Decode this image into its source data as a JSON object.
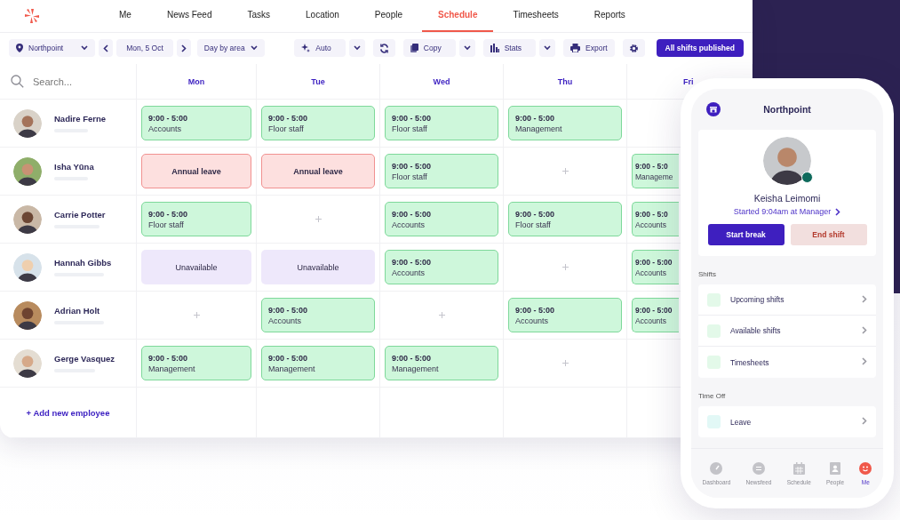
{
  "nav": [
    {
      "label": "Me",
      "selected": false
    },
    {
      "label": "News Feed",
      "selected": false
    },
    {
      "label": "Tasks",
      "selected": false
    },
    {
      "label": "Location",
      "selected": false
    },
    {
      "label": "People",
      "selected": false
    },
    {
      "label": "Schedule",
      "selected": true
    },
    {
      "label": "Timesheets",
      "selected": false
    },
    {
      "label": "Reports",
      "selected": false
    }
  ],
  "toolbar": {
    "location": "Northpoint",
    "date": "Mon, 5 Oct",
    "view": "Day by area",
    "actions": [
      {
        "kind": "auto",
        "label": "Auto"
      },
      {
        "kind": "refresh"
      },
      {
        "kind": "copy",
        "label": "Copy"
      },
      {
        "kind": "stats",
        "label": "Stats"
      },
      {
        "kind": "export",
        "label": "Export"
      },
      {
        "kind": "settings"
      }
    ],
    "publish": "All shifts published"
  },
  "search": {
    "placeholder": "Search..."
  },
  "days": [
    "Mon",
    "Tue",
    "Wed",
    "Thu",
    "Fri"
  ],
  "employees": [
    {
      "name": "Nadire Ferne",
      "cells": [
        {
          "kind": "shift",
          "time": "9:00 - 5:00",
          "area": "Accounts"
        },
        {
          "kind": "shift",
          "time": "9:00 - 5:00",
          "area": "Floor staff"
        },
        {
          "kind": "shift",
          "time": "9:00 - 5:00",
          "area": "Floor staff"
        },
        {
          "kind": "shift",
          "time": "9:00 - 5:00",
          "area": "Management"
        },
        {
          "kind": "blank"
        }
      ]
    },
    {
      "name": "Isha Yūna",
      "cells": [
        {
          "kind": "leave",
          "label": "Annual leave"
        },
        {
          "kind": "leave",
          "label": "Annual leave"
        },
        {
          "kind": "shift",
          "time": "9:00 - 5:00",
          "area": "Floor staff"
        },
        {
          "kind": "empty"
        },
        {
          "kind": "shift",
          "time": "9:00 - 5:0",
          "area": "Manageme"
        }
      ]
    },
    {
      "name": "Carrie Potter",
      "cells": [
        {
          "kind": "shift",
          "time": "9:00 - 5:00",
          "area": "Floor staff"
        },
        {
          "kind": "empty"
        },
        {
          "kind": "shift",
          "time": "9:00 - 5:00",
          "area": "Accounts"
        },
        {
          "kind": "shift",
          "time": "9:00 - 5:00",
          "area": "Floor staff"
        },
        {
          "kind": "shift",
          "time": "9:00 - 5:0",
          "area": "Accounts"
        }
      ]
    },
    {
      "name": "Hannah Gibbs",
      "cells": [
        {
          "kind": "unavailable",
          "label": "Unavailable"
        },
        {
          "kind": "unavailable",
          "label": "Unavailable"
        },
        {
          "kind": "shift",
          "time": "9:00 - 5:00",
          "area": "Accounts"
        },
        {
          "kind": "empty"
        },
        {
          "kind": "shift",
          "time": "9:00 - 5:00",
          "area": "Accounts"
        }
      ]
    },
    {
      "name": "Adrian Holt",
      "cells": [
        {
          "kind": "empty"
        },
        {
          "kind": "shift",
          "time": "9:00 - 5:00",
          "area": "Accounts"
        },
        {
          "kind": "empty"
        },
        {
          "kind": "shift",
          "time": "9:00 - 5:00",
          "area": "Accounts"
        },
        {
          "kind": "shift",
          "time": "9:00 - 5:00",
          "area": "Accounts"
        }
      ]
    },
    {
      "name": "Gerge Vasquez",
      "cells": [
        {
          "kind": "shift",
          "time": "9:00 - 5:00",
          "area": "Management"
        },
        {
          "kind": "shift",
          "time": "9:00 - 5:00",
          "area": "Management"
        },
        {
          "kind": "shift",
          "time": "9:00 - 5:00",
          "area": "Management"
        },
        {
          "kind": "empty"
        },
        {
          "kind": "blank"
        }
      ]
    }
  ],
  "add_employee": "+ Add new employee",
  "phone": {
    "title": "Northpoint",
    "profile": {
      "name": "Keisha Leimomi",
      "status": "Started 9:04am at Manager"
    },
    "start_break": "Start break",
    "end_shift": "End shift",
    "sections": [
      {
        "heading": "Shifts",
        "items": [
          {
            "label": "Upcoming shifts",
            "color": "#e3f9e9"
          },
          {
            "label": "Available shifts",
            "color": "#e3f9e9"
          },
          {
            "label": "Timesheets",
            "color": "#e3f9e9"
          }
        ]
      },
      {
        "heading": "Time Off",
        "items": [
          {
            "label": "Leave",
            "color": "#e2f8f6"
          }
        ]
      }
    ],
    "tabs": [
      {
        "kind": "dashboard",
        "label": "Dashboard",
        "selected": false
      },
      {
        "kind": "newsfeed",
        "label": "Newsfeed",
        "selected": false
      },
      {
        "kind": "schedule",
        "label": "Schedule",
        "selected": false
      },
      {
        "kind": "people",
        "label": "People",
        "selected": false
      },
      {
        "kind": "me",
        "label": "Me",
        "selected": true
      }
    ]
  }
}
